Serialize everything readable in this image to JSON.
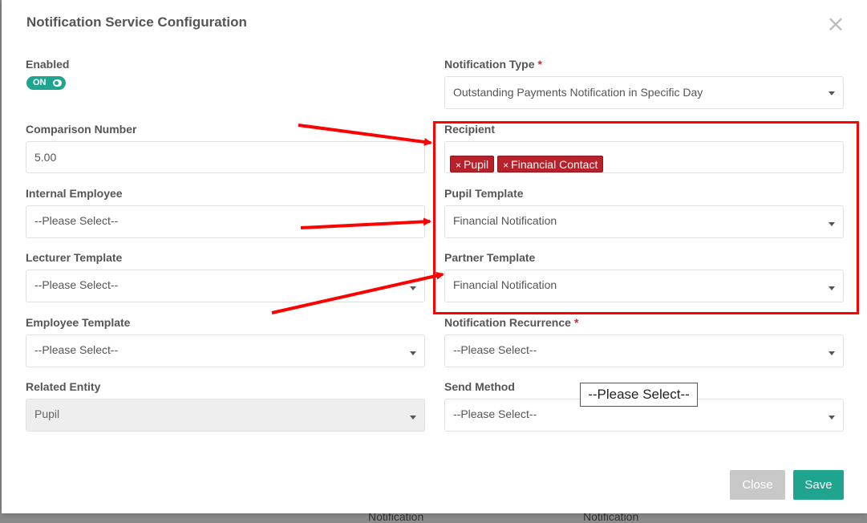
{
  "modal": {
    "title": "Notification Service Configuration"
  },
  "fields": {
    "enabled": {
      "label": "Enabled",
      "toggle_text": "ON"
    },
    "notification_type": {
      "label": "Notification Type",
      "value": "Outstanding Payments Notification in Specific Day",
      "required": "*"
    },
    "comparison_number": {
      "label": "Comparison Number",
      "value": "5.00"
    },
    "recipient": {
      "label": "Recipient",
      "tags": [
        "Pupil",
        "Financial Contact"
      ],
      "tag_remove": "×"
    },
    "internal_employee": {
      "label": "Internal Employee",
      "value": "--Please Select--"
    },
    "pupil_template": {
      "label": "Pupil Template",
      "value": "Financial Notification"
    },
    "lecturer_template": {
      "label": "Lecturer Template",
      "value": "--Please Select--"
    },
    "partner_template": {
      "label": "Partner Template",
      "value": "Financial Notification"
    },
    "employee_template": {
      "label": "Employee Template",
      "value": "--Please Select--"
    },
    "notification_recurrence": {
      "label": "Notification Recurrence",
      "value": "--Please Select--",
      "required": "*"
    },
    "related_entity": {
      "label": "Related Entity",
      "value": "Pupil"
    },
    "send_method": {
      "label": "Send Method",
      "value": "--Please Select--"
    }
  },
  "tooltip": {
    "text": "--Please Select--"
  },
  "buttons": {
    "close": "Close",
    "save": "Save"
  },
  "background_text": [
    "Notification",
    "Notification"
  ],
  "icons": {
    "close": "close-icon",
    "dropdown": "chevron-down-icon"
  },
  "colors": {
    "accent": "#1fa58f",
    "tag": "#b8202a",
    "annotation": "#ff0000"
  }
}
